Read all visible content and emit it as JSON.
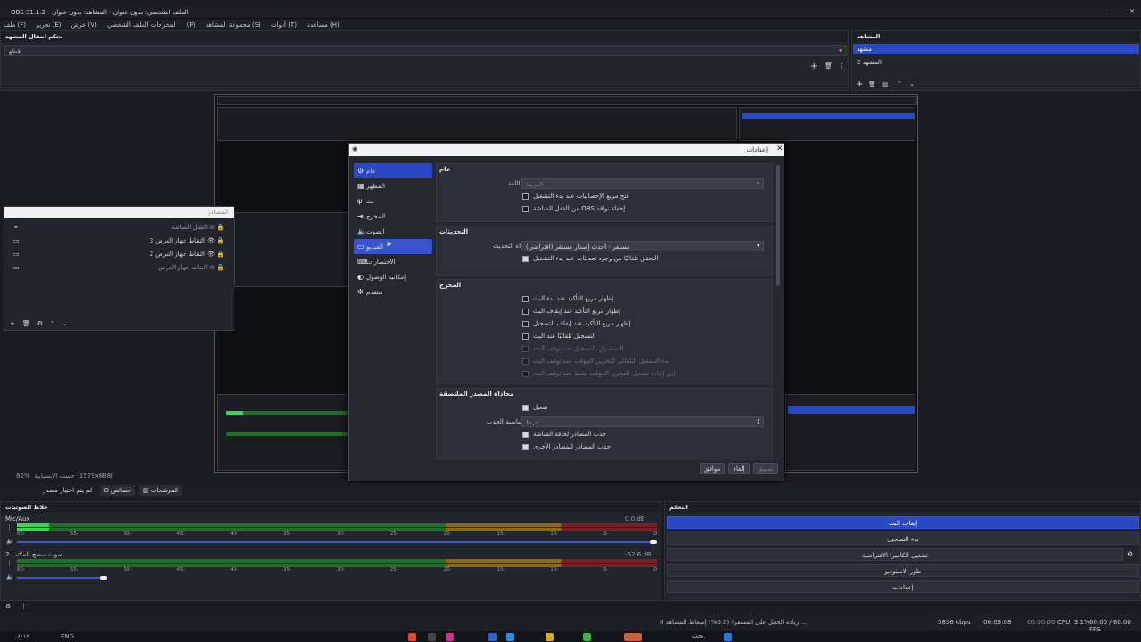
{
  "window": {
    "title": "OBS 31.1.2 - الملف الشخصي: بدون عنوان - المشاهد: بدون عنوان"
  },
  "menu": {
    "items": [
      "ملف (F)",
      "تحرير (E)",
      "عرض (V)",
      "المخرجات",
      "الملف الشخصي (P)",
      "مجموعة المشاهد (S)",
      "أدوات (T)",
      "مساعدة (H)"
    ]
  },
  "transitions": {
    "title": "تحكم انتقال المشهد",
    "value": "قطع"
  },
  "scenes": {
    "title": "المشاهد",
    "items": [
      "مشهد",
      "المشهد 2"
    ]
  },
  "sources": {
    "title": "المصادر",
    "items": [
      "القفل الشاشة",
      "التقاط جهاز العرض 3",
      "التقاط جهاز العرض 2",
      "التقاط جهاز العرض"
    ]
  },
  "dialog": {
    "title": "إعدادات",
    "nav": [
      "عام",
      "المظهر",
      "بث",
      "المخرج",
      "الصوت",
      "الفيديو",
      "الاختصارات",
      "إمكانية الوصول",
      "متقدم"
    ],
    "general": {
      "section": "عام",
      "language_label": "اللغة",
      "language_value": "العربية",
      "options": [
        "فتح مربع الإحصائيات عند بدء التشغيل",
        "من القفل الشاشة OBS إخفاء نوافذ"
      ]
    },
    "updates": {
      "section": "التحديثات",
      "channel_label": "قناة التحديث",
      "channel_value": "مستقر - أحدث إصدار مستقر (افتراضي)",
      "option": "التحقق تلقائيًا من وجود تحديثات عند بدء التشغيل"
    },
    "output": {
      "section": "المخرج",
      "options": [
        "إظهار مربع التأكيد عند بدء البث",
        "إظهار مربع التأكيد عند إيقاف البث",
        "إظهار مربع التأكيد عند إيقاف التسجيل",
        "التسجيل تلقائيًا عند البث"
      ],
      "disabled": [
        "الاستمرار بالتسجيل عند توقف البث",
        "بدء التشغيل التلقائي للتخزين المؤقت عند توقف البث",
        "إبق إعادة تشغيل المخزن المؤقت نشط عند توقف البث"
      ]
    },
    "snapping": {
      "section": "محاذاة المصدر الملتصقة",
      "enable_label": "تفعيل",
      "sensitivity_label": "حساسية الجذب",
      "sensitivity_value": "١٠,٠",
      "options": [
        "جذب المصادر لحافة الشاشة",
        "جذب المصادر للمصادر الأخرى"
      ]
    },
    "buttons": {
      "ok": "موافق",
      "cancel": "إلغاء",
      "apply": "تطبيق"
    }
  },
  "preview": {
    "zoom": "82%",
    "size_label": "حسب الإنسيابية (1579x888)"
  },
  "mixer": {
    "title": "خلاط الصوتيات",
    "channels": [
      {
        "name": "Mic/Aux",
        "db": "0.0 dB",
        "level": 0.05,
        "volume": 1.0
      },
      {
        "name": "صوت سطح المكتب 2",
        "db": "-62.6 dB",
        "level": 0.0,
        "volume": 0.14
      }
    ],
    "ticks": [
      "60-",
      "55-",
      "50-",
      "45-",
      "40-",
      "35-",
      "30-",
      "25-",
      "20-",
      "15-",
      "10-",
      "5-",
      "0"
    ]
  },
  "controls": {
    "title": "التحكم",
    "buttons": [
      "إيقاف البث",
      "بدء التسجيل",
      "تشغيل الكاميرا الافتراضية",
      "طور الاستوديو",
      "إعدادات"
    ]
  },
  "tabs": {
    "items": [
      "لم يتم اختيار مصدر",
      "خصائص",
      "المرشحات"
    ]
  },
  "status": {
    "message": "زيادة الحمل على المشفر! (0.0%) إسقاط المشاهد 0 ...",
    "bitrate": "5836 kbps",
    "stream_time": "00:03:08",
    "rec_time": "00:00:00",
    "cpu": "CPU: 3.1%",
    "fps": "60.00 / 60.00 FPS"
  },
  "taskbar": {
    "time": "٠٤:١٢",
    "lang": "ENG",
    "search": "بحث"
  },
  "colors": {
    "accent": "#2a49c8",
    "meter_green": "#3bd84e",
    "meter_yellow": "#8a6a12",
    "meter_red": "#7a1f24"
  }
}
